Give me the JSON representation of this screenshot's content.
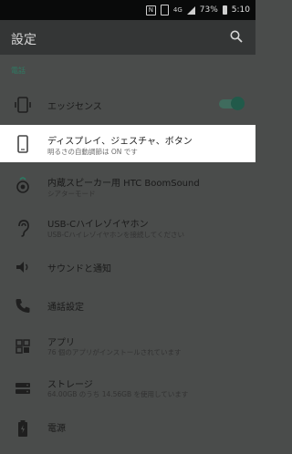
{
  "status_bar": {
    "nfc": "N",
    "network": "4G",
    "battery": "73%",
    "time": "5:10"
  },
  "toolbar": {
    "title": "設定"
  },
  "section": {
    "header": "電話"
  },
  "items": [
    {
      "label": "エッジセンス",
      "sub": "",
      "icon": "edge-sense-icon",
      "toggle": true
    },
    {
      "label": "ディスプレイ、ジェスチャ、ボタン",
      "sub": "明るさの自動調節は ON です",
      "icon": "phone-display-icon"
    },
    {
      "label": "内蔵スピーカー用 HTC BoomSound",
      "sub": "シアターモード",
      "icon": "boomsound-icon"
    },
    {
      "label": "USB-Cハイレゾイヤホン",
      "sub": "USB-Cハイレゾイヤホンを接続してください",
      "icon": "ear-icon"
    },
    {
      "label": "サウンドと通知",
      "sub": "",
      "icon": "speaker-icon"
    },
    {
      "label": "通話設定",
      "sub": "",
      "icon": "phone-call-icon"
    },
    {
      "label": "アプリ",
      "sub": "76 個のアプリがインストールされています",
      "icon": "apps-icon"
    },
    {
      "label": "ストレージ",
      "sub": "64.00GB のうち 14.56GB を使用しています",
      "icon": "storage-icon"
    },
    {
      "label": "電源",
      "sub": "",
      "icon": "battery-icon"
    }
  ]
}
